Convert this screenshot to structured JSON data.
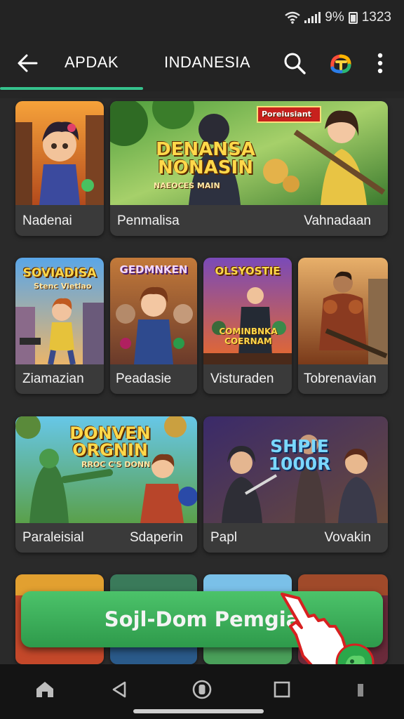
{
  "status_bar": {
    "battery_percent": "9%",
    "time": "1323",
    "wifi_icon": "wifi-icon",
    "signal_icon": "signal-icon",
    "battery_icon": "battery-icon"
  },
  "app_bar": {
    "back_icon": "arrow-left-icon",
    "tabs": [
      {
        "label": "APDAK",
        "selected": true
      },
      {
        "label": "INDANESIA",
        "selected": false
      }
    ],
    "search_icon": "search-icon",
    "more_icon": "more-vert-icon",
    "accent_color": "#35c28d"
  },
  "games": [
    {
      "label": "Nadenai",
      "art_title": "",
      "art_sub": ""
    },
    {
      "labels": [
        "Penmalisa",
        "Vahnadaan"
      ],
      "art_title": "DENANSA NONASIN",
      "art_sub": "NAEOCES MAIN",
      "badge": "Poreiusiant"
    },
    {
      "label": "Ziamazian",
      "art_title": "SOVIADISA",
      "art_sub": "Stenc Vietlao"
    },
    {
      "label": "Peadasie",
      "art_title": "GEDMNKEN",
      "art_sub": ""
    },
    {
      "label": "Visturaden",
      "art_title": "OLSYOSTIE",
      "art_sub": "COMINBNKA COERNAM"
    },
    {
      "label": "Tobrenavian",
      "art_title": "",
      "art_sub": ""
    },
    {
      "labels": [
        "Paraleisial",
        "Sdaperin"
      ],
      "art_title": "DONVEN ORGNIN",
      "art_sub": "RROC C'S DONN"
    },
    {
      "labels": [
        "Papl",
        "Vovakin"
      ],
      "art_title": "SHPIE 1000R",
      "art_sub": ""
    }
  ],
  "cta": {
    "label": "Sojl-Dom Pemgia",
    "color": "#3cb35a"
  },
  "nav_bar": {
    "icons": [
      "home-icon",
      "back-triangle-icon",
      "recents-circle-icon",
      "square-icon",
      "tray-icon"
    ]
  }
}
